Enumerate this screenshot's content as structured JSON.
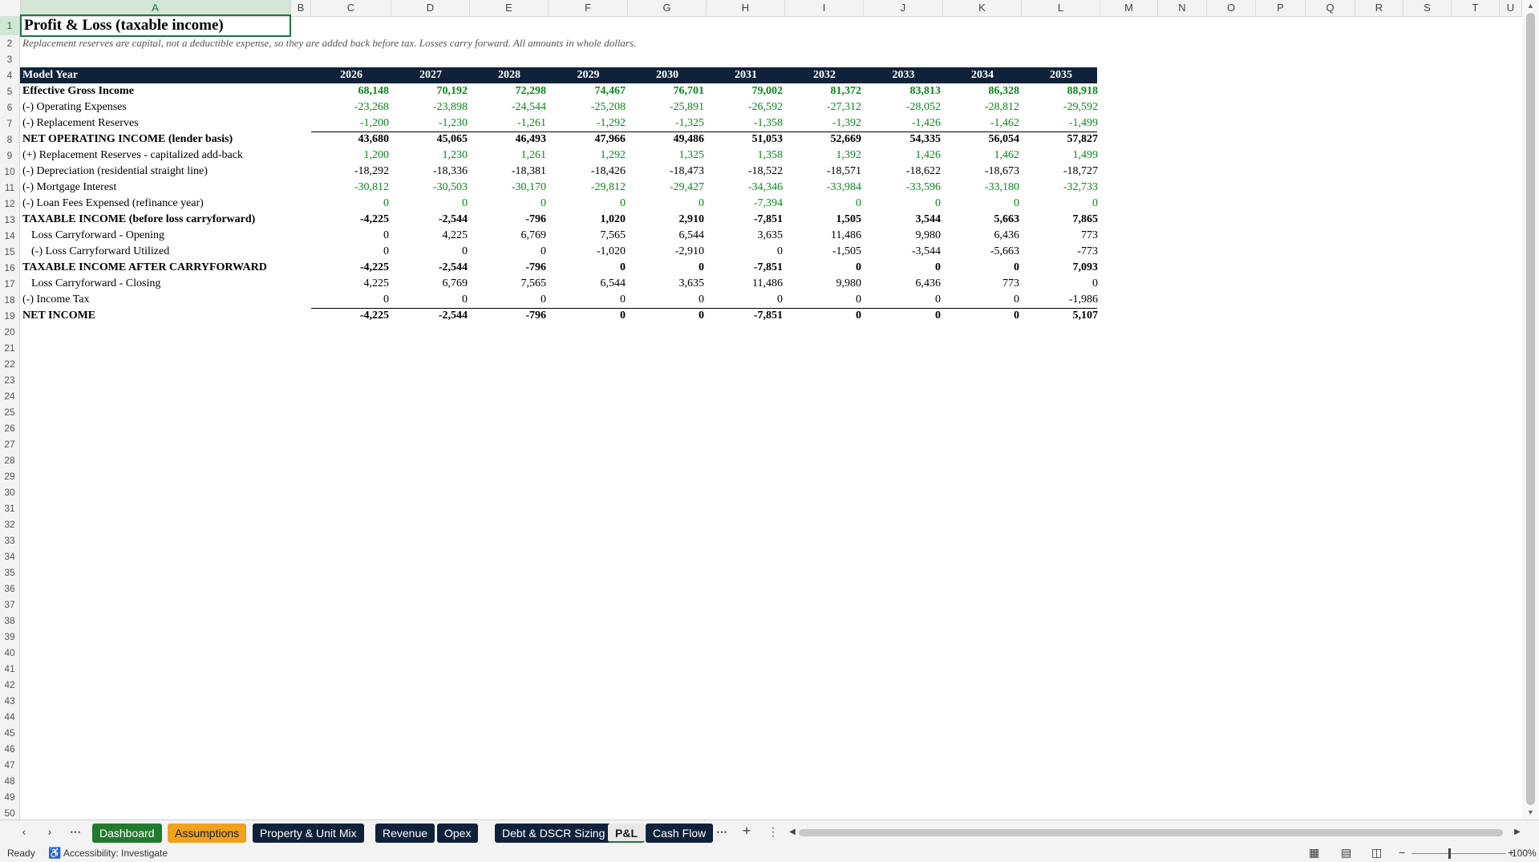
{
  "col_headers": [
    "A",
    "B",
    "C",
    "D",
    "E",
    "F",
    "G",
    "H",
    "I",
    "J",
    "K",
    "L",
    "M",
    "N",
    "O",
    "P",
    "Q",
    "R",
    "S",
    "T",
    "U"
  ],
  "selected_column": "A",
  "selected_row": 1,
  "sheet": {
    "title": "Profit & Loss (taxable income)",
    "note": "Replacement reserves are capital, not a deductible expense, so they are added back before tax. Losses carry forward. All amounts in whole dollars.",
    "header_label": "Model Year",
    "years": [
      "2026",
      "2027",
      "2028",
      "2029",
      "2030",
      "2031",
      "2032",
      "2033",
      "2034",
      "2035"
    ],
    "rows": [
      {
        "row": 5,
        "label": "Effective Gross Income",
        "bold": true,
        "green": true,
        "values": [
          "68,148",
          "70,192",
          "72,298",
          "74,467",
          "76,701",
          "79,002",
          "81,372",
          "83,813",
          "86,328",
          "88,918"
        ]
      },
      {
        "row": 6,
        "label": "(-) Operating Expenses",
        "green": true,
        "values": [
          "-23,268",
          "-23,898",
          "-24,544",
          "-25,208",
          "-25,891",
          "-26,592",
          "-27,312",
          "-28,052",
          "-28,812",
          "-29,592"
        ]
      },
      {
        "row": 7,
        "label": "(-) Replacement Reserves",
        "green": true,
        "values": [
          "-1,200",
          "-1,230",
          "-1,261",
          "-1,292",
          "-1,325",
          "-1,358",
          "-1,392",
          "-1,426",
          "-1,462",
          "-1,499"
        ]
      },
      {
        "row": 8,
        "label": "NET OPERATING INCOME (lender basis)",
        "bold": true,
        "topline": true,
        "values": [
          "43,680",
          "45,065",
          "46,493",
          "47,966",
          "49,486",
          "51,053",
          "52,669",
          "54,335",
          "56,054",
          "57,827"
        ]
      },
      {
        "row": 9,
        "label": "(+) Replacement Reserves - capitalized add-back",
        "green": true,
        "values": [
          "1,200",
          "1,230",
          "1,261",
          "1,292",
          "1,325",
          "1,358",
          "1,392",
          "1,426",
          "1,462",
          "1,499"
        ]
      },
      {
        "row": 10,
        "label": "(-) Depreciation (residential straight line)",
        "values": [
          "-18,292",
          "-18,336",
          "-18,381",
          "-18,426",
          "-18,473",
          "-18,522",
          "-18,571",
          "-18,622",
          "-18,673",
          "-18,727"
        ]
      },
      {
        "row": 11,
        "label": "(-) Mortgage Interest",
        "green": true,
        "values": [
          "-30,812",
          "-30,503",
          "-30,170",
          "-29,812",
          "-29,427",
          "-34,346",
          "-33,984",
          "-33,596",
          "-33,180",
          "-32,733"
        ]
      },
      {
        "row": 12,
        "label": "(-) Loan Fees Expensed (refinance year)",
        "green": true,
        "values": [
          "0",
          "0",
          "0",
          "0",
          "0",
          "-7,394",
          "0",
          "0",
          "0",
          "0"
        ]
      },
      {
        "row": 13,
        "label": "TAXABLE INCOME (before loss carryforward)",
        "bold": true,
        "values": [
          "-4,225",
          "-2,544",
          "-796",
          "1,020",
          "2,910",
          "-7,851",
          "1,505",
          "3,544",
          "5,663",
          "7,865"
        ]
      },
      {
        "row": 14,
        "label": "Loss Carryforward - Opening",
        "indent": true,
        "values": [
          "0",
          "4,225",
          "6,769",
          "7,565",
          "6,544",
          "3,635",
          "11,486",
          "9,980",
          "6,436",
          "773"
        ]
      },
      {
        "row": 15,
        "label": "(-) Loss Carryforward Utilized",
        "indent": true,
        "values": [
          "0",
          "0",
          "0",
          "-1,020",
          "-2,910",
          "0",
          "-1,505",
          "-3,544",
          "-5,663",
          "-773"
        ]
      },
      {
        "row": 16,
        "label": "TAXABLE INCOME AFTER CARRYFORWARD",
        "bold": true,
        "values": [
          "-4,225",
          "-2,544",
          "-796",
          "0",
          "0",
          "-7,851",
          "0",
          "0",
          "0",
          "7,093"
        ]
      },
      {
        "row": 17,
        "label": "Loss Carryforward - Closing",
        "indent": true,
        "values": [
          "4,225",
          "6,769",
          "7,565",
          "6,544",
          "3,635",
          "11,486",
          "9,980",
          "6,436",
          "773",
          "0"
        ]
      },
      {
        "row": 18,
        "label": "(-) Income Tax",
        "values": [
          "0",
          "0",
          "0",
          "0",
          "0",
          "0",
          "0",
          "0",
          "0",
          "-1,986"
        ]
      },
      {
        "row": 19,
        "label": "NET INCOME",
        "bold": true,
        "topline": true,
        "values": [
          "-4,225",
          "-2,544",
          "-796",
          "0",
          "0",
          "-7,851",
          "0",
          "0",
          "0",
          "5,107"
        ]
      }
    ]
  },
  "row_count": 50,
  "tabs": [
    {
      "label": "Dashboard",
      "color": "#217a2f",
      "text": "#ffffff"
    },
    {
      "label": "Assumptions",
      "color": "#f0a21d",
      "text": "#1a1a1a"
    },
    {
      "label": "Property & Unit Mix",
      "color": "#0f2239",
      "text": "#ffffff"
    },
    {
      "label": "Revenue",
      "color": "#0f2239",
      "text": "#ffffff"
    },
    {
      "label": "Opex",
      "color": "#0f2239",
      "text": "#ffffff"
    },
    {
      "label": "Debt & DSCR Sizing",
      "color": "#0f2239",
      "text": "#ffffff"
    },
    {
      "label": "P&L",
      "color": "#e8e8e8",
      "text": "#1a1a1a",
      "active": true
    },
    {
      "label": "Cash Flow",
      "color": "#0f2239",
      "text": "#ffffff"
    }
  ],
  "status": {
    "ready": "Ready",
    "accessibility": "Accessibility: Investigate",
    "zoom": "100%"
  }
}
